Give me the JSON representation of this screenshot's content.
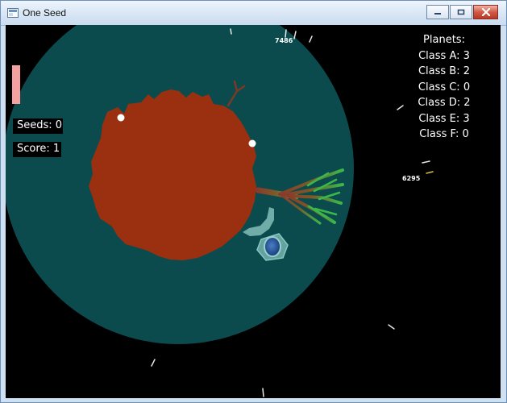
{
  "window": {
    "title": "One Seed",
    "icons": {
      "app": "window-app-icon",
      "minimize": "minimize-icon",
      "maximize": "maximize-icon",
      "close": "close-icon"
    }
  },
  "hud": {
    "seeds": "Seeds: 0",
    "score": "Score: 1",
    "planets": {
      "header": "Planets:",
      "classes": [
        "Class A: 3",
        "Class B: 2",
        "Class C: 0",
        "Class D: 2",
        "Class E: 3",
        "Class F: 0"
      ]
    },
    "energy_colors": {
      "bar": "#f4a0a0"
    },
    "distance_markers": [
      "7486",
      "6295"
    ]
  },
  "colors": {
    "space": "#000000",
    "planet": "#0b4b4e",
    "core": "#9b3010",
    "branch_root": "#8b3a2a",
    "branch_tip": "#3bb84a",
    "creature": "#7bb5b0",
    "eye": "#1b4f93"
  }
}
